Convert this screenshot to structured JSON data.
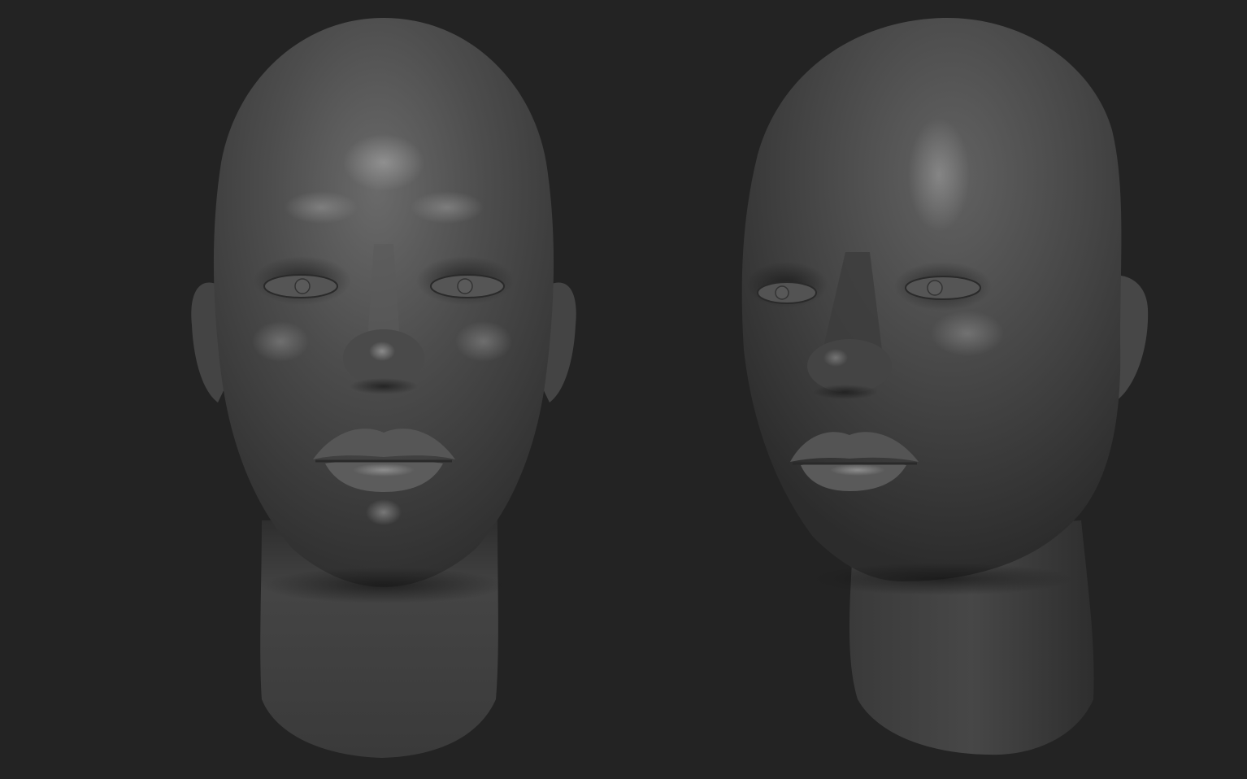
{
  "viewport": {
    "background_color": "#232323"
  },
  "subjects": [
    {
      "id": "front-view",
      "view": "front",
      "description_name": "sculpted-head-front-view",
      "clay_color": "#4b4b4b"
    },
    {
      "id": "three-quarter-view",
      "view": "three-quarter",
      "description_name": "sculpted-head-three-quarter-view",
      "clay_color": "#4a4a4a"
    }
  ]
}
